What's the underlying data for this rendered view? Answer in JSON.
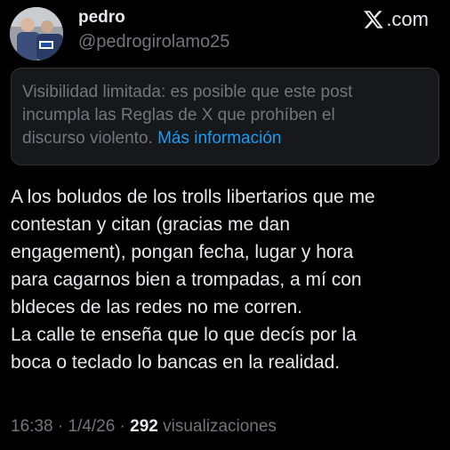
{
  "author": {
    "name": "pedro",
    "handle": "@pedrogirolamo25"
  },
  "brand": {
    "text": ".com",
    "logo_icon": "x-logo-icon"
  },
  "notice": {
    "text": "Visibilidad limitada: es posible que este post incumpla las Reglas de X que prohíben el discurso violento.",
    "line1": "Visibilidad limitada: es posible que este post",
    "line2": "incumpla las Reglas de X que prohíben el",
    "line3_prefix": "discurso violento.",
    "link": "Más información"
  },
  "tweet": {
    "lines": [
      "A los boludos de los trolls libertarios que me",
      "contestan y citan (gracias me dan",
      "engagement), pongan fecha, lugar y hora",
      "para cagarnos bien a trompadas, a mí con",
      "bldeces de las redes no me corren.",
      "La calle te enseña que lo que decís por la",
      "boca o teclado lo bancas en la realidad."
    ]
  },
  "meta": {
    "time": "16:38",
    "separator": "·",
    "date": "1/4/26",
    "views_count": "292",
    "views_label": "visualizaciones"
  },
  "colors": {
    "background": "#000000",
    "text_primary": "#e7e9ea",
    "text_secondary": "#71767b",
    "link": "#1d9bf0",
    "notice_bg": "#16181c",
    "notice_border": "#2f3336"
  }
}
